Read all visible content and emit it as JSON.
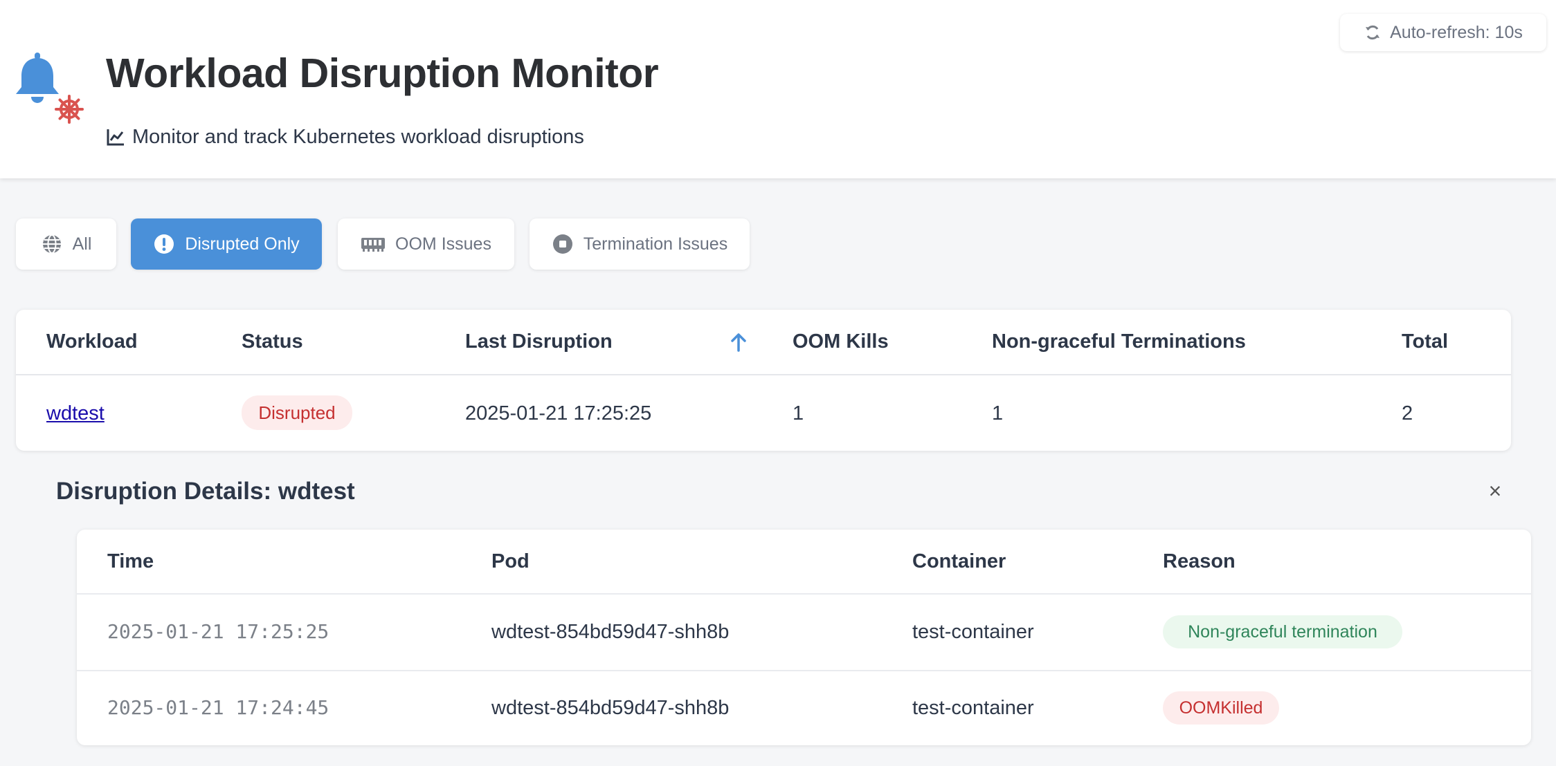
{
  "header": {
    "title": "Workload Disruption Monitor",
    "subtitle": "Monitor and track Kubernetes workload disruptions",
    "logo_icons": [
      "bell-icon",
      "kubernetes-helm-icon"
    ],
    "auto_refresh": "Auto-refresh: 10s"
  },
  "filters": [
    {
      "label": "All",
      "icon": "globe-icon",
      "active": false
    },
    {
      "label": "Disrupted Only",
      "icon": "exclamation-circle-icon",
      "active": true
    },
    {
      "label": "OOM Issues",
      "icon": "memory-icon",
      "active": false
    },
    {
      "label": "Termination Issues",
      "icon": "stop-circle-icon",
      "active": false
    }
  ],
  "workloads_table": {
    "columns": [
      "Workload",
      "Status",
      "Last Disruption",
      "OOM Kills",
      "Non-graceful Terminations",
      "Total"
    ],
    "sort": {
      "column": "Last Disruption",
      "direction": "ascending"
    },
    "rows": [
      {
        "workload": "wdtest",
        "status": "Disrupted",
        "last_disruption": "2025-01-21 17:25:25",
        "oom_kills": "1",
        "non_graceful_terminations": "1",
        "total": "2"
      }
    ]
  },
  "details": {
    "title": "Disruption Details: wdtest",
    "close_label": "×",
    "columns": [
      "Time",
      "Pod",
      "Container",
      "Reason"
    ],
    "rows": [
      {
        "time": "2025-01-21 17:25:25",
        "pod": "wdtest-854bd59d47-shh8b",
        "container": "test-container",
        "reason": "Non-graceful termination"
      },
      {
        "time": "2025-01-21 17:24:45",
        "pod": "wdtest-854bd59d47-shh8b",
        "container": "test-container",
        "reason": "OOMKilled"
      }
    ]
  },
  "colors": {
    "accent": "#4a90d9",
    "disrupted_text": "#c53030",
    "disrupted_bg": "#fdecec",
    "success_text": "#2f855a",
    "success_bg": "#ebf8ee",
    "helm_red": "#d9534f"
  }
}
